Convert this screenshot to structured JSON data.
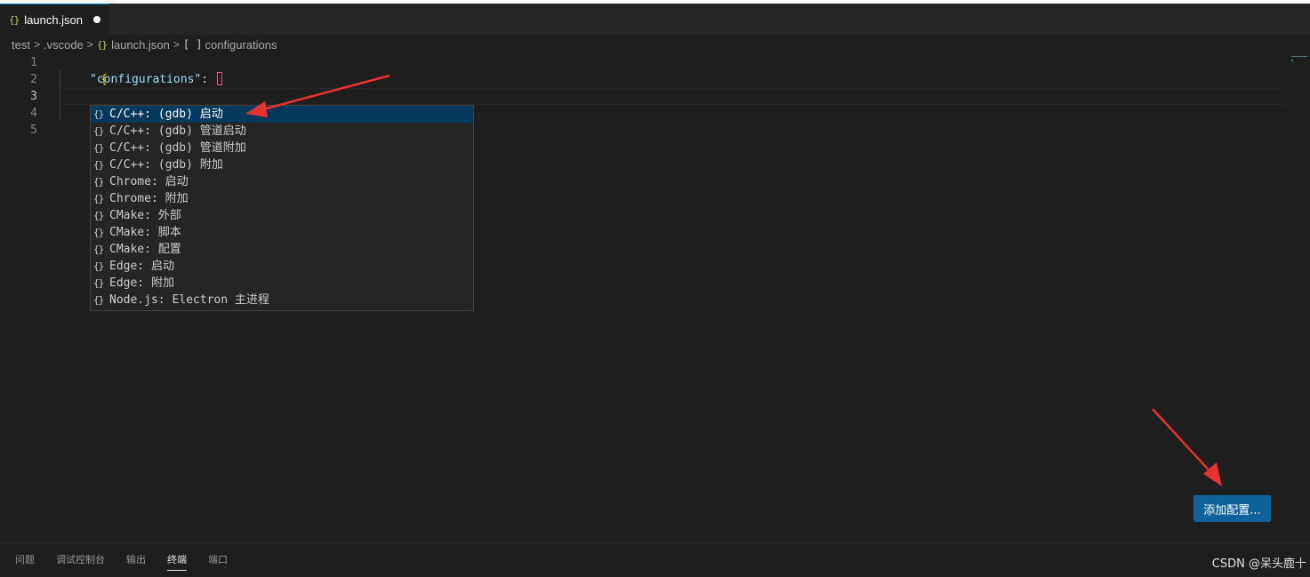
{
  "tab": {
    "icon": "json-braces-icon",
    "label": "launch.json",
    "dirty_icon": "dirty-dot"
  },
  "breadcrumb": {
    "items": [
      "test",
      ".vscode",
      "launch.json",
      "configurations"
    ],
    "separator": ">",
    "file_icon": "{}",
    "array_icon": "[ ]"
  },
  "editor": {
    "line_numbers": [
      "1",
      "2",
      "3",
      "4",
      "5"
    ],
    "lines": {
      "open_brace": "{",
      "key": "\"configurations\"",
      "colon": ": ",
      "close_brace": "}"
    }
  },
  "suggest": {
    "icon": "{}",
    "items": [
      "C/C++: (gdb) 启动",
      "C/C++: (gdb) 管道启动",
      "C/C++: (gdb) 管道附加",
      "C/C++: (gdb) 附加",
      "Chrome: 启动",
      "Chrome: 附加",
      "CMake: 外部",
      "CMake: 脚本",
      "CMake: 配置",
      "Edge: 启动",
      "Edge: 附加",
      "Node.js: Electron 主进程"
    ],
    "selected_index": 0
  },
  "add_config_button": {
    "label": "添加配置..."
  },
  "panel": {
    "tabs": [
      "问题",
      "调试控制台",
      "输出",
      "终端",
      "端口"
    ],
    "active": "终端"
  },
  "watermark": "CSDN @呆头鹿十",
  "colors": {
    "accent": "#0e639c",
    "arrow": "#e8322d",
    "selection": "#04395e"
  }
}
